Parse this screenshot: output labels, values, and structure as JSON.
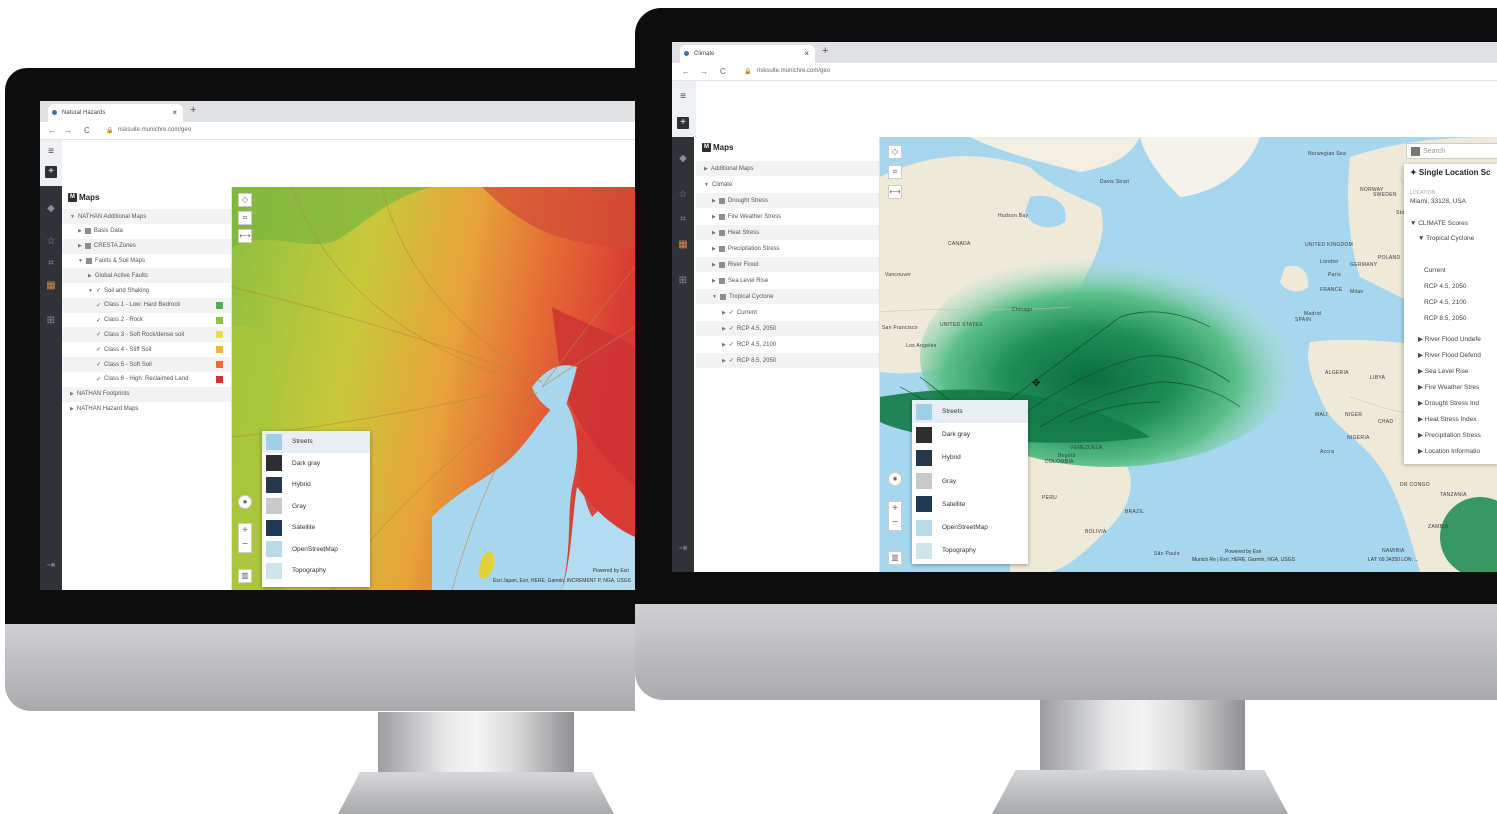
{
  "left_screen": {
    "tab_title": "Natural Hazards",
    "tab_close": "×",
    "tab_new": "+",
    "nav_back": "←",
    "nav_forward": "→",
    "nav_reload": "C",
    "lock": "🔒",
    "url": "risksuite.munichre.com/geo",
    "panel_badge": "M",
    "panel_title": "Maps",
    "tree": [
      {
        "caret": "▼",
        "label": "NATHAN Additional Maps",
        "indent": 8
      },
      {
        "caret": "▶",
        "label": "Basis Data",
        "indent": 16,
        "box": true
      },
      {
        "caret": "▶",
        "label": "CRESTA Zones",
        "indent": 16,
        "box": true
      },
      {
        "caret": "▼",
        "label": "Faults & Soil Maps",
        "indent": 16,
        "box": true
      },
      {
        "caret": "▶",
        "label": "Global Active Faults",
        "indent": 26
      },
      {
        "caret": "▼",
        "check": "✓",
        "label": "Soil and Shaking",
        "indent": 26
      },
      {
        "check": "✓",
        "label": "Class 1 - Low: Hard Bedrock",
        "indent": 34,
        "color": "#4caf50"
      },
      {
        "check": "✓",
        "label": "Class 2 - Rock",
        "indent": 34,
        "color": "#8bc34a"
      },
      {
        "check": "✓",
        "label": "Class 3 - Soft Rock/dense soil",
        "indent": 34,
        "color": "#e6e13a"
      },
      {
        "check": "✓",
        "label": "Class 4 - Stiff Soil",
        "indent": 34,
        "color": "#f5b335"
      },
      {
        "check": "✓",
        "label": "Class 5 - Soft Soil",
        "indent": 34,
        "color": "#ef6c2f"
      },
      {
        "check": "✓",
        "label": "Class 6 - High: Reclaimed Land",
        "indent": 34,
        "color": "#d32f2f"
      },
      {
        "caret": "▶",
        "label": "NATHAN Footprints",
        "indent": 8
      },
      {
        "caret": "▶",
        "label": "NATHAN Hazard Maps",
        "indent": 8
      }
    ],
    "basemaps": [
      "Streets",
      "Dark gray",
      "Hybrid",
      "Gray",
      "Satellite",
      "OpenStreetMap",
      "Topography"
    ],
    "attribution_1": "Powered by Esri",
    "attribution_2": "Esri Japan, Esri, HERE, Garmin, INCREMENT P, NGA, USGS"
  },
  "right_screen": {
    "tab_title": "Climate",
    "tab_close": "×",
    "tab_new": "+",
    "nav_back": "←",
    "nav_forward": "→",
    "nav_reload": "C",
    "lock": "🔒",
    "url": "risksuite.munichre.com/geo",
    "panel_badge": "M",
    "panel_title": "Maps",
    "tree": [
      {
        "caret": "▶",
        "label": "Additional Maps",
        "indent": 8
      },
      {
        "caret": "▼",
        "label": "Climate",
        "indent": 8
      },
      {
        "caret": "▶",
        "label": "Drought Stress",
        "indent": 16,
        "box": true
      },
      {
        "caret": "▶",
        "label": "Fire Weather Stress",
        "indent": 16,
        "box": true
      },
      {
        "caret": "▶",
        "label": "Heat Stress",
        "indent": 16,
        "box": true
      },
      {
        "caret": "▶",
        "label": "Precipitation Stress",
        "indent": 16,
        "box": true
      },
      {
        "caret": "▶",
        "label": "River Flood",
        "indent": 16,
        "box": true
      },
      {
        "caret": "▶",
        "label": "Sea Level Rise",
        "indent": 16,
        "box": true
      },
      {
        "caret": "▼",
        "label": "Tropical Cyclone",
        "indent": 16,
        "box": true
      },
      {
        "caret": "▶",
        "check": "✓",
        "label": "Current",
        "indent": 26
      },
      {
        "caret": "▶",
        "check": "✓",
        "label": "RCP 4.5, 2050",
        "indent": 26
      },
      {
        "caret": "▶",
        "check": "✓",
        "label": "RCP 4.5, 2100",
        "indent": 26
      },
      {
        "caret": "▶",
        "check": "✓",
        "label": "RCP 8.5, 2050",
        "indent": 26
      }
    ],
    "basemaps": [
      "Streets",
      "Dark gray",
      "Hybrid",
      "Gray",
      "Satellite",
      "OpenStreetMap",
      "Topography"
    ],
    "search_placeholder": "Search",
    "location_panel": {
      "title": "Single Location Sc",
      "location_caption": "LOCATION",
      "location_value": "Miami, 33128, USA",
      "climate_scores": "CLIMATE Scores",
      "tropical_cyclone": "Tropical Cyclone",
      "scenarios": [
        "Current",
        "RCP 4.5, 2050",
        "RCP 4.5, 2100",
        "RCP 8.5, 2050"
      ],
      "sections": [
        "River Flood Undefe",
        "River Flood Defend",
        "Sea Level Rise",
        "Fire Weather Stres",
        "Drought Stress Ind",
        "Heat Stress Index",
        "Precipitation Stress",
        "Location Informatio"
      ]
    },
    "map_labels": {
      "canada": "CANADA",
      "united_states": "UNITED STATES",
      "vancouver": "Vancouver",
      "san_francisco": "San Francisco",
      "los_angeles": "Los Angeles",
      "chicago": "Chicago",
      "hudson_bay": "Hudson Bay",
      "davis_strait": "Davis Strait",
      "norwegian_sea": "Norwegian Sea",
      "norway": "NORWAY",
      "united_kingdom": "UNITED KINGDOM",
      "london": "London",
      "germany": "GERMANY",
      "poland": "POLAND",
      "paris": "Paris",
      "france": "FRANCE",
      "spain": "SPAIN",
      "madrid": "Madrid",
      "milan": "Milan",
      "algeria": "ALGERIA",
      "libya": "LIBYA",
      "mali": "MALI",
      "niger": "NIGER",
      "chad": "CHAD",
      "nigeria": "NIGERIA",
      "accra": "Accra",
      "venezuela": "VENEZUELA",
      "colombia": "COLOMBIA",
      "bogota": "Bogotá",
      "peru": "PERU",
      "brazil": "BRAZIL",
      "bolivia": "BOLIVIA",
      "sao_paulo": "São Paulo",
      "dr_congo": "DR CONGO",
      "tanzania": "TANZANIA",
      "zambia": "ZAMBIA",
      "namibia": "NAMIBIA",
      "stockholm": "Stockholm",
      "sweden": "SWEDEN"
    },
    "attribution_1": "Powered by Esri",
    "attribution_2": "Munich Re | Esri, HERE, Garmin, NGA, USGS",
    "coords": "LAT: 69.34250  LON: ..."
  },
  "icons": {
    "layers": "layers-icon",
    "add": "add-icon",
    "globe": "globe-icon",
    "star": "star-icon",
    "measure": "measure-icon",
    "map": "map-icon",
    "grid": "grid-icon",
    "logout": "logout-icon"
  }
}
